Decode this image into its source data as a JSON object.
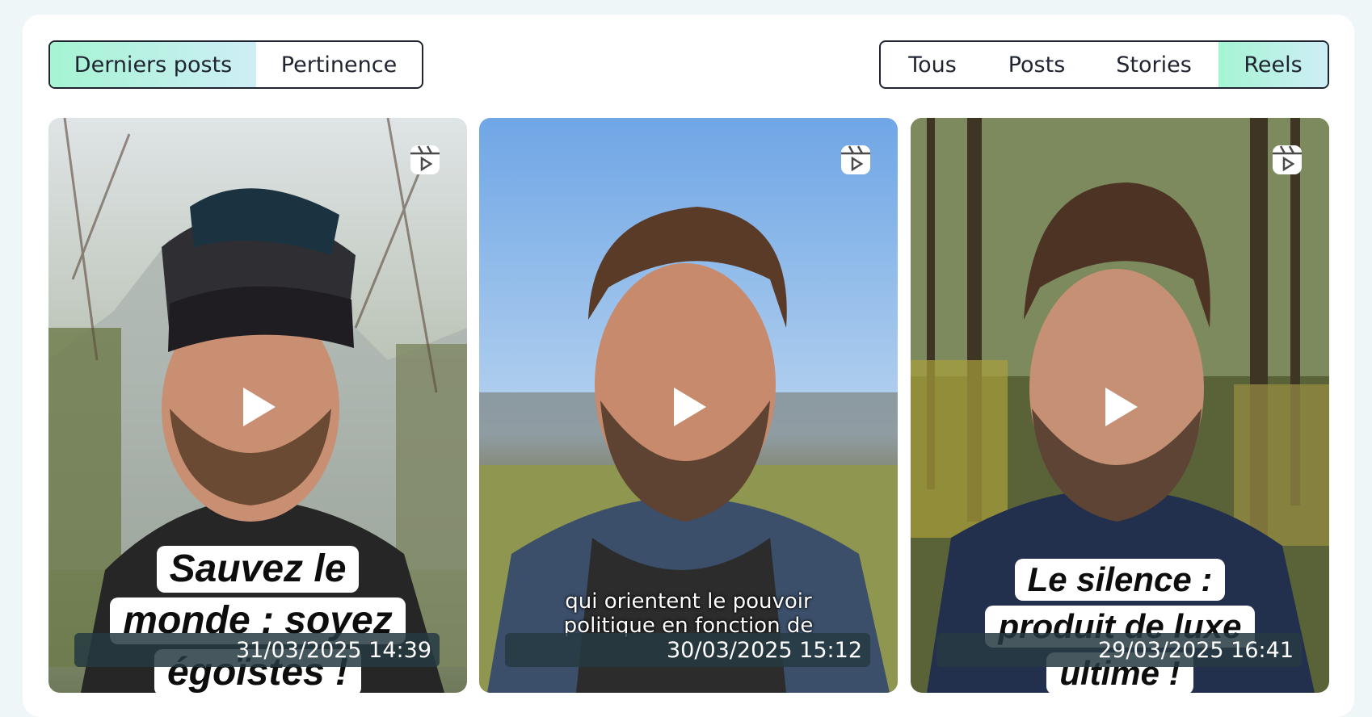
{
  "sort_tabs": [
    {
      "label": "Derniers posts",
      "active": true
    },
    {
      "label": "Pertinence",
      "active": false
    }
  ],
  "type_tabs": [
    {
      "label": "Tous",
      "active": false
    },
    {
      "label": "Posts",
      "active": false
    },
    {
      "label": "Stories",
      "active": false
    },
    {
      "label": "Reels",
      "active": true
    }
  ],
  "posts": [
    {
      "type": "reel",
      "caption_lines": [
        "Sauvez le",
        "monde : soyez",
        "égoïstes !"
      ],
      "subtitle": "",
      "date": "31/03/2025 14:39"
    },
    {
      "type": "reel",
      "caption_lines": [],
      "subtitle_lines": [
        "qui orientent le pouvoir",
        "politique en fonction de"
      ],
      "date": "30/03/2025 15:12"
    },
    {
      "type": "reel",
      "caption_lines": [
        "Le silence :",
        "produit de luxe",
        "ultime !"
      ],
      "subtitle": "",
      "date": "29/03/2025 16:41"
    }
  ],
  "colors": {
    "accent_gradient_start": "#a5f4d3",
    "accent_gradient_end": "#cfeef6",
    "border": "#1f2430",
    "page_bg": "#eef6f8"
  },
  "icons": {
    "reel": "reel-icon",
    "play": "play-icon"
  }
}
